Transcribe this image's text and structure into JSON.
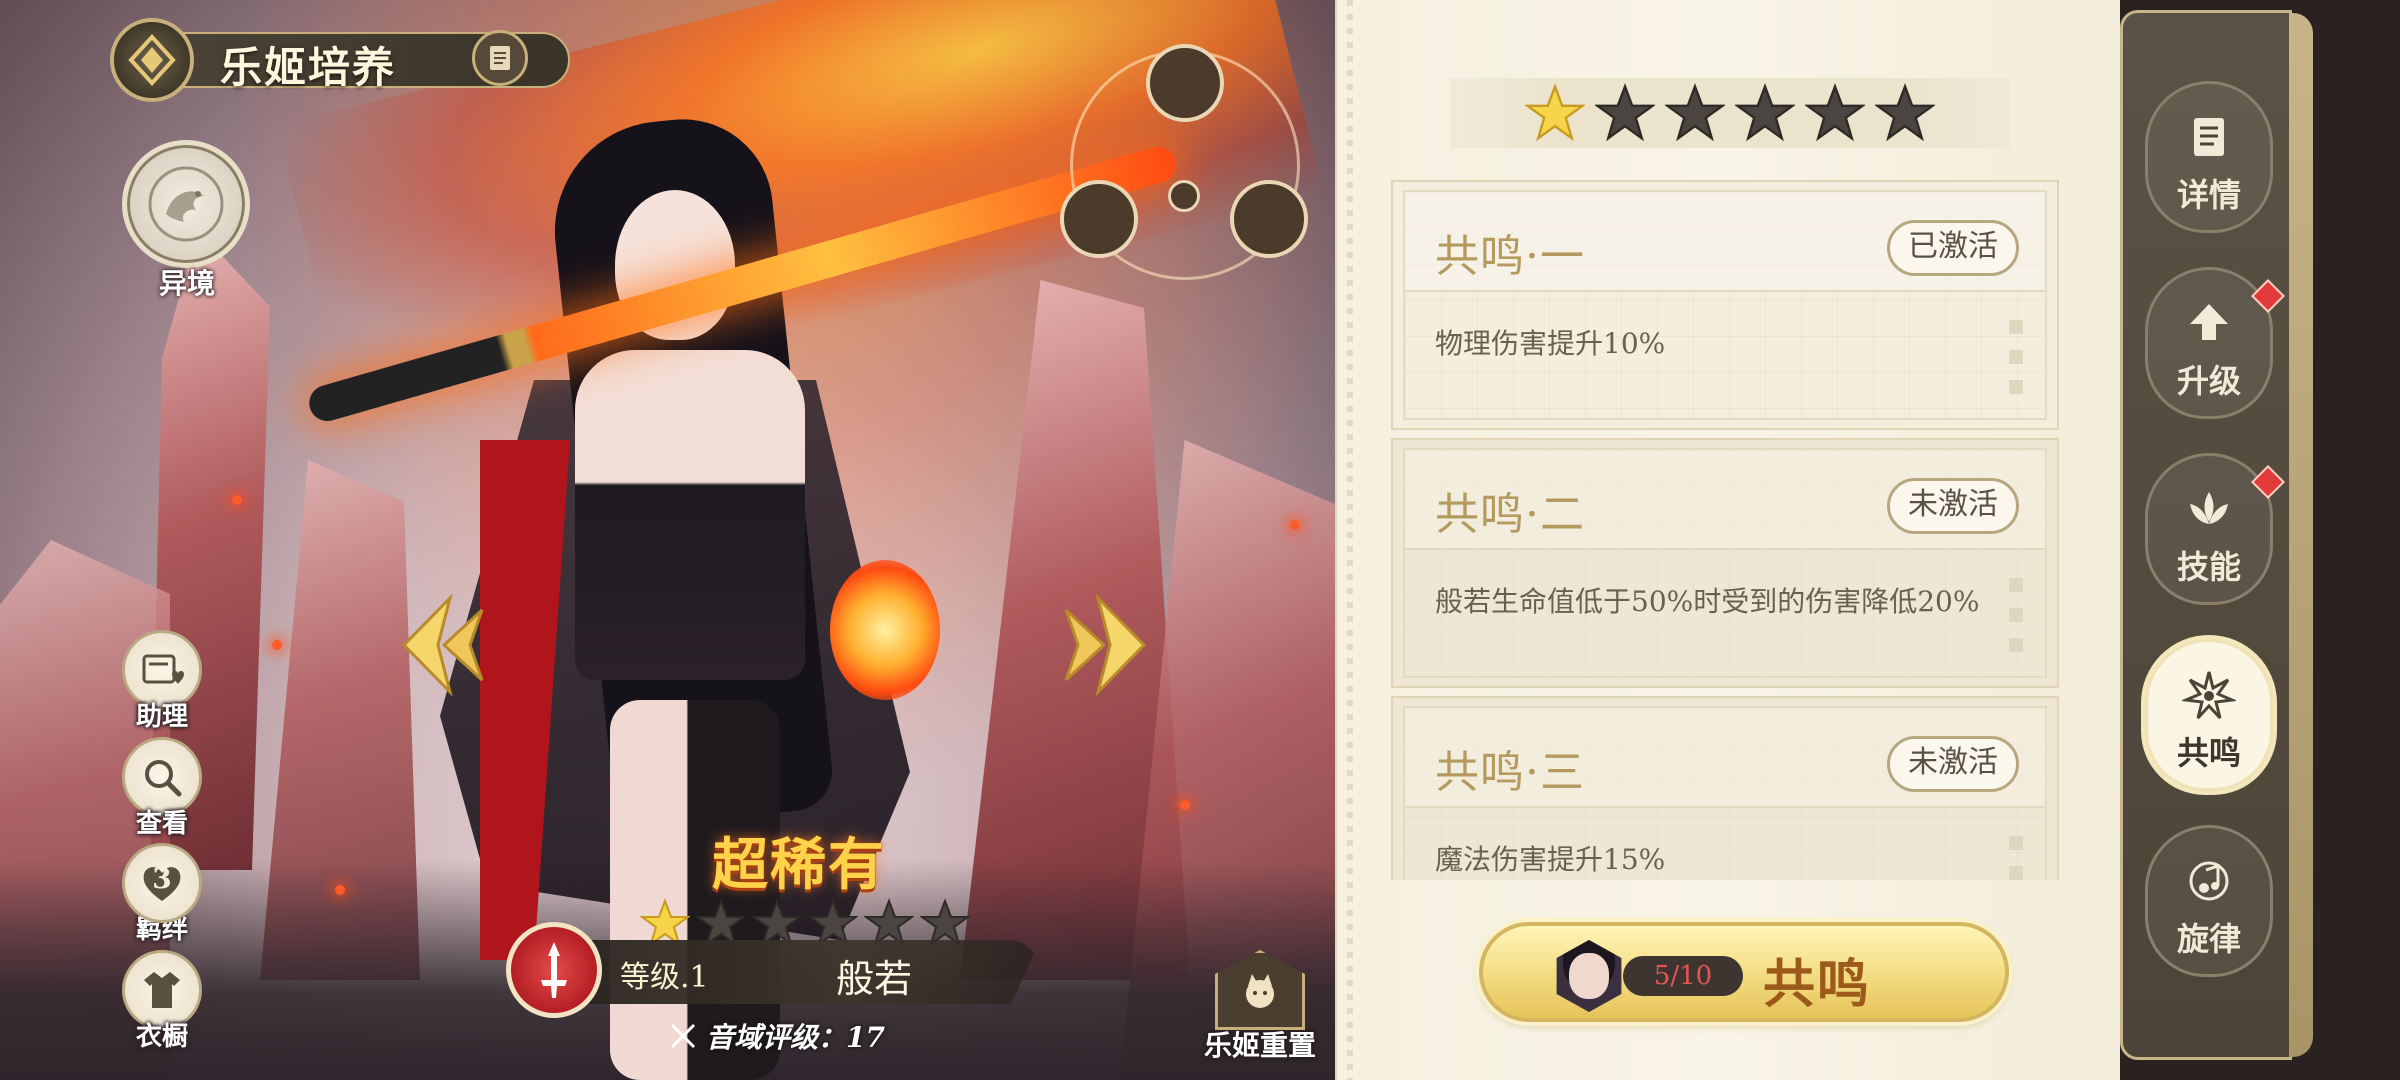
{
  "header": {
    "title": "乐姬培养"
  },
  "left_menu": {
    "realm": "异境",
    "buttons": [
      {
        "id": "assist",
        "label": "助理",
        "icon": "card-heart-icon"
      },
      {
        "id": "view",
        "label": "查看",
        "icon": "magnifier-icon"
      },
      {
        "id": "bond",
        "label": "羁绊",
        "badge": "3",
        "icon": "heart-icon"
      },
      {
        "id": "wardrobe",
        "label": "衣橱",
        "icon": "outfit-icon"
      }
    ]
  },
  "character": {
    "rarity": "超稀有",
    "stars_total": 6,
    "stars_filled": 1,
    "level": "等级.1",
    "name": "般若",
    "rating": "音域评级：17"
  },
  "reset": {
    "label": "乐姬重置"
  },
  "resonance_stars": {
    "total": 6,
    "filled": 1
  },
  "resonances": [
    {
      "title": "共鸣·一",
      "status": "已激活",
      "desc": "物理伤害提升10%",
      "active": true
    },
    {
      "title": "共鸣·二",
      "status": "未激活",
      "desc": "般若生命值低于50%时受到的伤害降低20%",
      "active": false
    },
    {
      "title": "共鸣·三",
      "status": "未激活",
      "desc": "魔法伤害提升15%",
      "active": false
    }
  ],
  "resonate_button": {
    "count": "5/10",
    "label": "共鸣"
  },
  "nav": [
    {
      "label": "详情",
      "icon": "scroll-icon",
      "dot": false
    },
    {
      "label": "升级",
      "icon": "arrow-up-icon",
      "dot": true
    },
    {
      "label": "技能",
      "icon": "lotus-icon",
      "dot": true
    },
    {
      "label": "共鸣",
      "icon": "burst-icon",
      "dot": false,
      "active": true
    },
    {
      "label": "旋律",
      "icon": "music-note-icon",
      "dot": false
    }
  ],
  "colors": {
    "star_filled": "#f6d54a",
    "star_empty": "#4a4540",
    "accent_gold": "#c8b07a",
    "count_red": "#e75454",
    "title_tan": "#b49a5e"
  }
}
